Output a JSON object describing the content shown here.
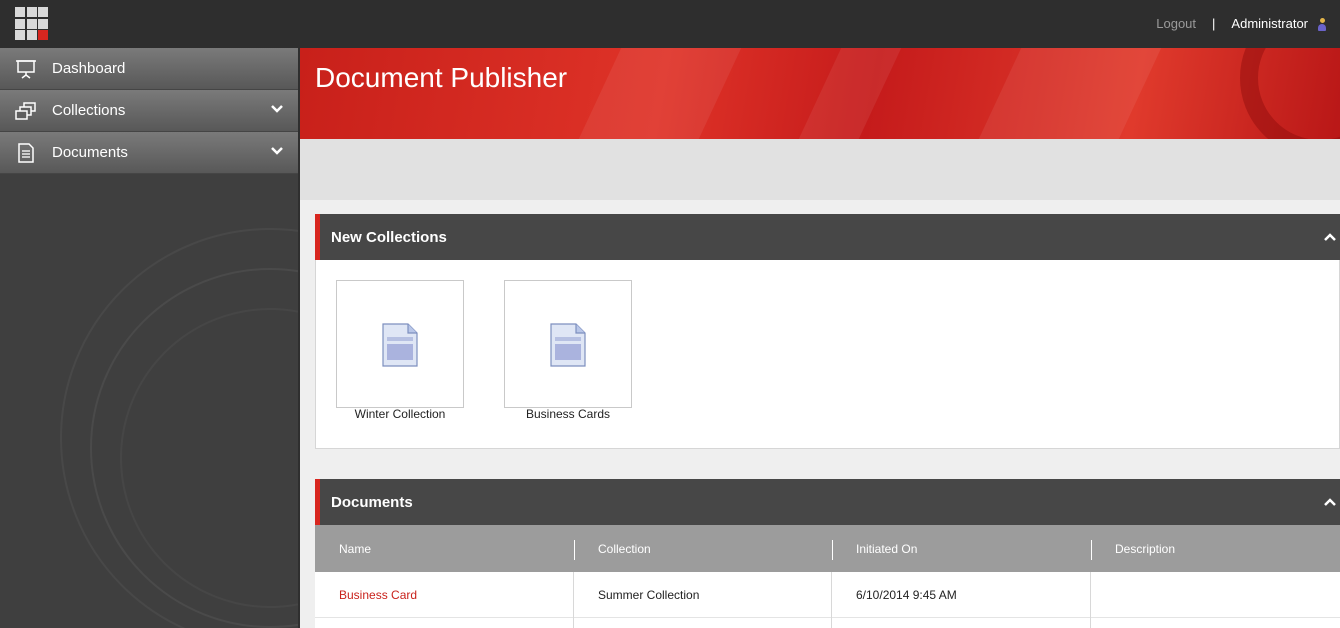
{
  "topbar": {
    "logout_label": "Logout",
    "separator": "|",
    "user_name": "Administrator"
  },
  "sidebar": {
    "items": [
      {
        "label": "Dashboard",
        "icon": "presentation-icon",
        "expandable": false
      },
      {
        "label": "Collections",
        "icon": "collections-icon",
        "expandable": true
      },
      {
        "label": "Documents",
        "icon": "document-icon",
        "expandable": true
      }
    ]
  },
  "header": {
    "title": "Document Publisher"
  },
  "new_collections": {
    "title": "New Collections",
    "items": [
      {
        "label": "Winter Collection",
        "icon": "collection-document-icon"
      },
      {
        "label": "Business Cards",
        "icon": "collection-document-icon"
      }
    ]
  },
  "documents": {
    "title": "Documents",
    "columns": [
      "Name",
      "Collection",
      "Initiated On",
      "Description"
    ],
    "rows": [
      {
        "name": "Business Card",
        "collection": "Summer Collection",
        "initiated_on": "6/10/2014 9:45 AM",
        "description": ""
      }
    ]
  },
  "colors": {
    "accent": "#d8261f",
    "topbar": "#2e2e2e",
    "sidebar": "#3f3f3f",
    "panel_header": "#474747",
    "grid_header": "#9c9c9c",
    "link": "#c9221c"
  }
}
